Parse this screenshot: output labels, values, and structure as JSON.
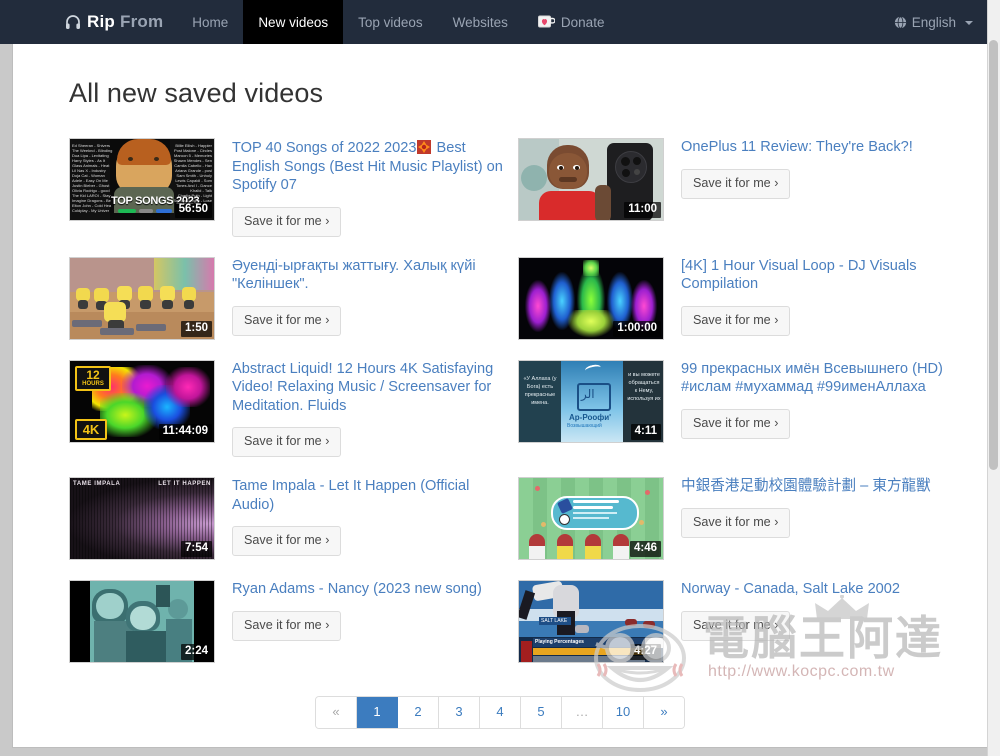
{
  "navbar": {
    "brand_primary": "Rip",
    "brand_secondary": "From",
    "brand_icon": "headphones-icon",
    "links": [
      {
        "label": "Home",
        "active": false,
        "icon": ""
      },
      {
        "label": "New videos",
        "active": true,
        "icon": ""
      },
      {
        "label": "Top videos",
        "active": false,
        "icon": ""
      },
      {
        "label": "Websites",
        "active": false,
        "icon": ""
      },
      {
        "label": "Donate",
        "active": false,
        "icon": "coffee-cup-heart-icon"
      }
    ],
    "language": {
      "label": "English",
      "icon": "globe-icon",
      "caret": "chevron-down-icon"
    },
    "bg_color": "#222c3c",
    "active_bg_color": "#000000"
  },
  "main": {
    "title": "All new saved videos",
    "save_button_label": "Save it for me ›",
    "videos": [
      {
        "title": "TOP 40 Songs of 2022 2023",
        "title_emoji": "burst-emoji",
        "title_after": " Best English Songs (Best Hit Music Playlist) on Spotify 07",
        "duration": "56:50",
        "thumb": "ed-sheeran-top-songs-2023"
      },
      {
        "title": "OnePlus 11 Review: They're Back?!",
        "title_emoji": "",
        "title_after": "",
        "duration": "11:00",
        "thumb": "phone-review-person"
      },
      {
        "title": "Әуенді-ырғақты жаттығу. Халық күйі \"Келіншек\".",
        "title_emoji": "",
        "title_after": "",
        "duration": "1:50",
        "thumb": "children-yellow-shirts"
      },
      {
        "title": "[4K] 1 Hour Visual Loop - DJ Visuals Compilation",
        "title_emoji": "",
        "title_after": "",
        "duration": "1:00:00",
        "thumb": "neon-dj-visuals"
      },
      {
        "title": "Abstract Liquid! 12 Hours 4K Satisfaying Video! Relaxing Music / Screensaver for Meditation. Fluids",
        "title_emoji": "",
        "title_after": "",
        "duration": "11:44:09",
        "thumb": "rainbow-ink-liquid",
        "badges": [
          "12 HOURS",
          "4K"
        ]
      },
      {
        "title": "99 прекрасных имён Всевышнего (HD) #ислам #мухаммад #99именАллаха",
        "title_emoji": "",
        "title_after": "",
        "duration": "4:11",
        "thumb": "islamic-names-sky"
      },
      {
        "title": "Tame Impala - Let It Happen (Official Audio)",
        "title_emoji": "",
        "title_after": "",
        "duration": "7:54",
        "thumb": "tame-impala-album-art",
        "overlay_left": "TAME IMPALA",
        "overlay_right": "LET IT HAPPEN"
      },
      {
        "title": "中銀香港足動校園體驗計劃 – 東方龍獸",
        "title_emoji": "",
        "title_after": "",
        "duration": "4:46",
        "thumb": "soccer-field-cartoon"
      },
      {
        "title": "Ryan Adams - Nancy (2023 new song)",
        "title_emoji": "",
        "title_after": "",
        "duration": "2:24",
        "thumb": "vintage-teal-couple"
      },
      {
        "title": "Norway - Canada, Salt Lake 2002",
        "title_emoji": "",
        "title_after": "",
        "duration": "4:27",
        "thumb": "curling-salt-lake",
        "overlay_text": "SALT LAKE",
        "overlay_stat": "Playing Percentages"
      }
    ]
  },
  "pagination": {
    "prev_label": "«",
    "next_label": "»",
    "pages": [
      "1",
      "2",
      "3",
      "4",
      "5",
      "…",
      "10"
    ],
    "active_page": "1",
    "active_color": "#3c7cbf"
  },
  "watermark": {
    "text": "電腦王阿達",
    "url": "http://www.kocpc.com.tw",
    "icon": "crown-icon"
  },
  "colors": {
    "link": "#4a7fbf",
    "navbar": "#222c3c",
    "accent": "#3c7cbf"
  }
}
